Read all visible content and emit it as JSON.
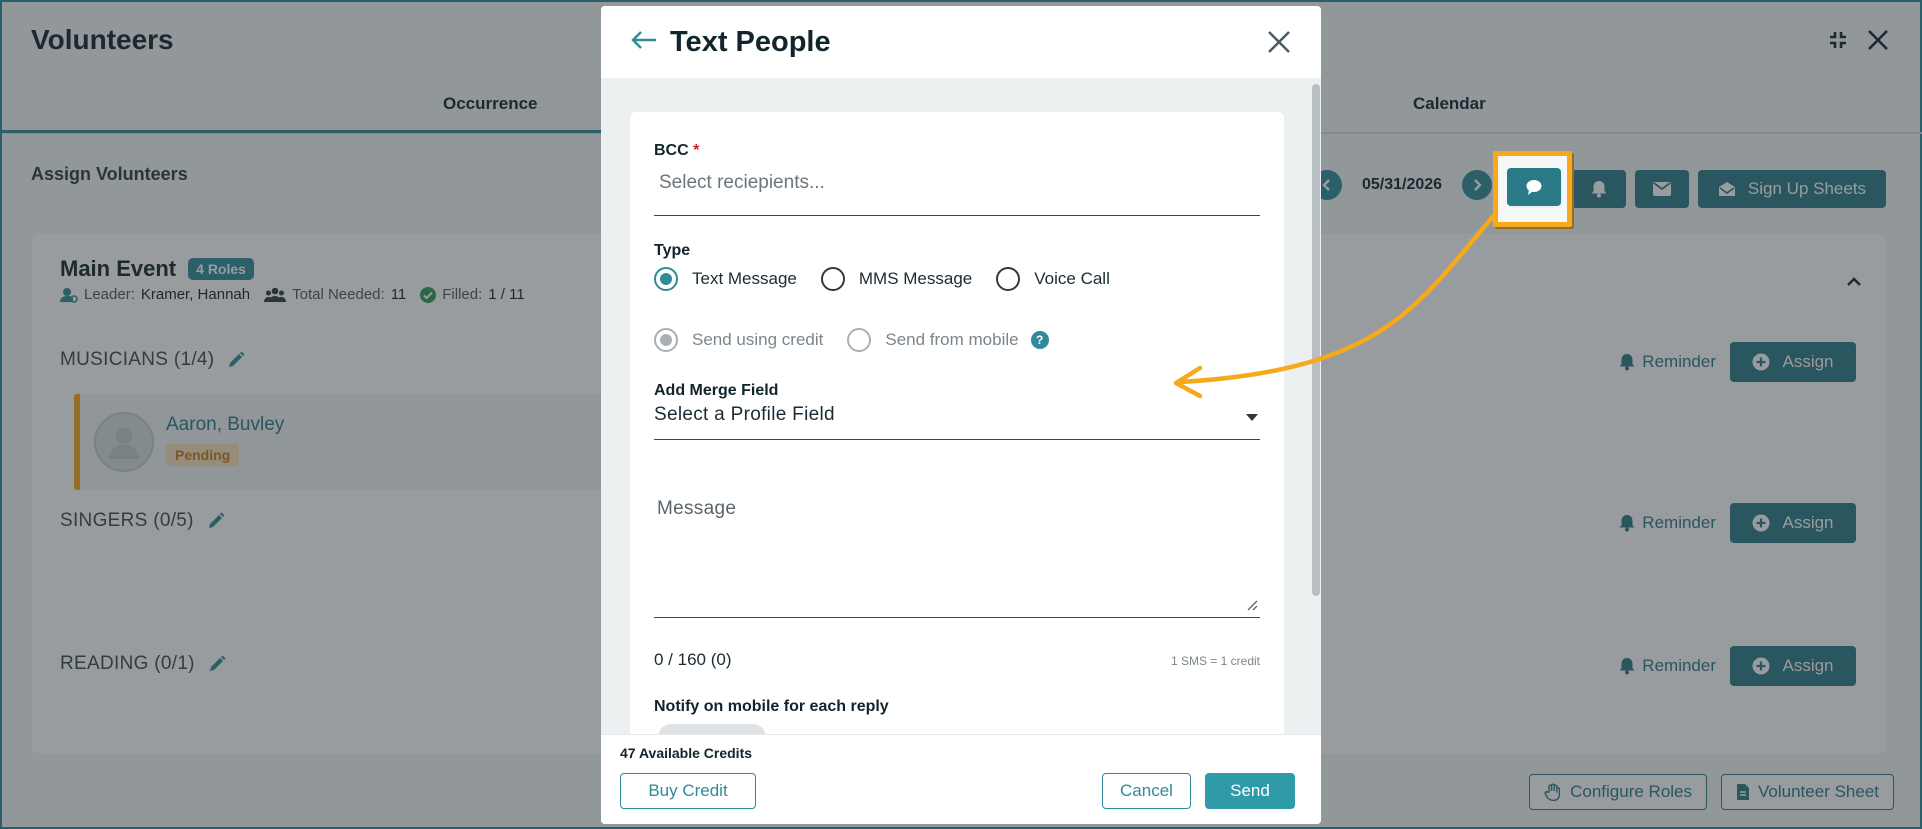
{
  "page": {
    "title": "Volunteers",
    "tabs": [
      "Occurrence",
      "Calendar"
    ],
    "section": "Assign Volunteers",
    "date": "05/31/2026",
    "signup_label": "Sign Up Sheets",
    "event": {
      "name": "Main Event",
      "roles_badge": "4 Roles",
      "leader_label": "Leader:",
      "leader_value": "Kramer, Hannah",
      "needed_label": "Total Needed:",
      "needed_value": "11",
      "filled_label": "Filled:",
      "filled_value": "1 / 11"
    },
    "roles": [
      {
        "name": "MUSICIANS (1/4)"
      },
      {
        "name": "SINGERS (0/5)"
      },
      {
        "name": "READING (0/1)"
      }
    ],
    "reminder_label": "Reminder",
    "assign_label": "Assign",
    "volunteer": {
      "name": "Aaron, Buvley",
      "status": "Pending"
    },
    "footer": {
      "configure_roles": "Configure Roles",
      "volunteer_sheet": "Volunteer Sheet"
    }
  },
  "modal": {
    "title": "Text People",
    "bcc_label": "BCC",
    "bcc_required": "*",
    "bcc_placeholder": "Select reciepients...",
    "type_label": "Type",
    "type_options": [
      "Text Message",
      "MMS Message",
      "Voice Call"
    ],
    "send_options": [
      "Send using credit",
      "Send from mobile"
    ],
    "help_glyph": "?",
    "merge_label": "Add Merge Field",
    "merge_value": "Select a Profile Field",
    "message_label": "Message",
    "counter": "0 / 160 (0)",
    "sms_note": "1 SMS = 1 credit",
    "notify_label": "Notify on mobile for each reply",
    "credits": "47 Available Credits",
    "buy_label": "Buy Credit",
    "cancel_label": "Cancel",
    "send_label": "Send"
  },
  "colors": {
    "accent": "#2f8a99",
    "highlight": "#f6a91b",
    "pending_bg": "#fae1bd",
    "required": "#d02030"
  },
  "icons": [
    "back-arrow-icon",
    "close-icon",
    "minimize-icon",
    "chat-bubble-icon",
    "bell-icon",
    "envelope-icon",
    "envelope-open-icon",
    "chevron-left-icon",
    "chevron-right-icon",
    "pencil-icon",
    "plus-circle-icon",
    "user-cog-icon",
    "users-icon",
    "check-circle-icon",
    "chevron-up-icon",
    "caret-down-icon",
    "hand-icon",
    "document-icon",
    "resize-handle-icon"
  ]
}
